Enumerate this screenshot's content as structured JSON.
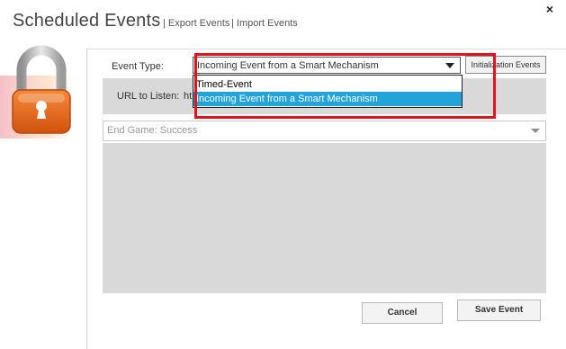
{
  "header": {
    "title": "Scheduled Events",
    "export_link": "| Export Events",
    "import_link": "| Import Events",
    "close_glyph": "×"
  },
  "form": {
    "event_type_label": "Event Type:",
    "event_type_selected": "Incoming Event from a Smart Mechanism",
    "init_button": "Initialization Events",
    "url_label": "URL to Listen:",
    "url_value": "ht",
    "game_outcome": "End Game: Success",
    "cancel_button": "Cancel",
    "save_button": "Save Event"
  },
  "dropdown": {
    "options": [
      "Timed-Event",
      "Incoming Event from a Smart Mechanism"
    ],
    "highlighted": "Incoming Event from a Smart Mechanism"
  },
  "colors": {
    "accent": "#22a3d9",
    "annotation": "#e3121b",
    "lock_orange": "#e8671e",
    "panel_gray": "#d9d9d9"
  },
  "icons": {
    "lock": "padlock-icon",
    "dropdown_arrow": "chevron-down-icon",
    "close": "close-icon"
  }
}
